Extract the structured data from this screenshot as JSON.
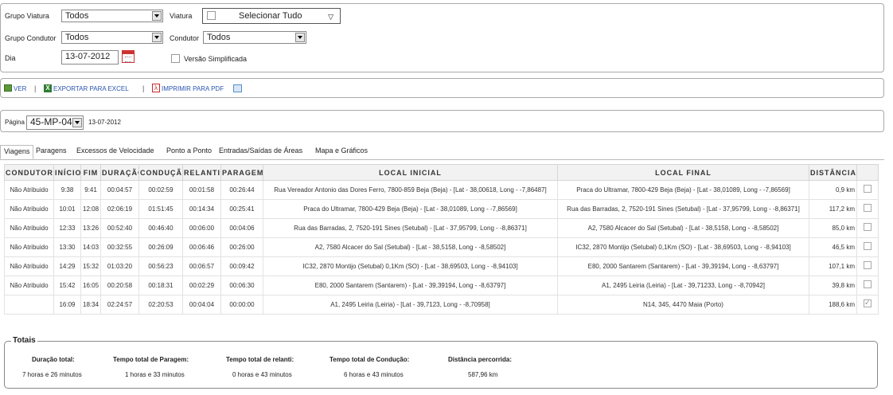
{
  "filters": {
    "grupo_viatura_label": "Grupo Viatura",
    "grupo_viatura_value": "Todos",
    "viatura_label": "Viatura",
    "viatura_value": "Selecionar Tudo",
    "grupo_condutor_label": "Grupo Condutor",
    "grupo_condutor_value": "Todos",
    "condutor_label": "Condutor",
    "condutor_value": "Todos",
    "dia_label": "Dia",
    "dia_value": "13-07-2012",
    "versao_label": "Versão Simplificada"
  },
  "toolbar": {
    "ver": "VER",
    "exportar": "EXPORTAR PARA EXCEL",
    "imprimir": "IMPRIMIR PARA PDF",
    "sep": "|"
  },
  "pager": {
    "label": "Página",
    "value": "45-MP-04",
    "date": "13-07-2012"
  },
  "tabs": [
    "Viagens",
    "Paragens",
    "Excessos de Velocidade",
    "Ponto a Ponto",
    "Entradas/Saídas de Áreas",
    "Mapa e Gráficos"
  ],
  "table": {
    "headers": [
      "CONDUTOR",
      "INÍCIO",
      "FIM",
      "DURAÇÃO",
      "CONDUÇÃO",
      "RELANTI",
      "PARAGEM",
      "LOCAL INICIAL",
      "LOCAL FINAL",
      "DISTÂNCIA",
      ""
    ],
    "rows": [
      [
        "Não Atribuido",
        "9:38",
        "9:41",
        "00:04:57",
        "00:02:59",
        "00:01:58",
        "00:26:44",
        "Rua Vereador Antonio das Dores Ferro, 7800-859 Beja (Beja) - [Lat - 38,00618, Long - -7,86487]",
        "Praca do Ultramar, 7800-429 Beja (Beja) - [Lat - 38,01089, Long - -7,86569]",
        "0,9 km"
      ],
      [
        "Não Atribuido",
        "10:01",
        "12:08",
        "02:06:19",
        "01:51:45",
        "00:14:34",
        "00:25:41",
        "Praca do Ultramar, 7800-429 Beja (Beja) - [Lat - 38,01089, Long - -7,86569]",
        "Rua das Barradas, 2, 7520-191 Sines (Setubal) - [Lat - 37,95799, Long - -8,86371]",
        "117,2 km"
      ],
      [
        "Não Atribuido",
        "12:33",
        "13:26",
        "00:52:40",
        "00:46:40",
        "00:06:00",
        "00:04:06",
        "Rua das Barradas, 2, 7520-191 Sines (Setubal) - [Lat - 37,95799, Long - -8,86371]",
        "A2, 7580 Alcacer do Sal (Setubal) - [Lat - 38,5158, Long - -8,58502]",
        "85,0 km"
      ],
      [
        "Não Atribuido",
        "13:30",
        "14:03",
        "00:32:55",
        "00:26:09",
        "00:06:46",
        "00:26:00",
        "A2, 7580 Alcacer do Sal (Setubal) - [Lat - 38,5158, Long - -8,58502]",
        "IC32, 2870 Montijo (Setubal) 0,1Km (SO) - [Lat - 38,69503, Long - -8,94103]",
        "46,5 km"
      ],
      [
        "Não Atribuido",
        "14:29",
        "15:32",
        "01:03:20",
        "00:56:23",
        "00:06:57",
        "00:09:42",
        "IC32, 2870 Montijo (Setubal) 0,1Km (SO) - [Lat - 38,69503, Long - -8,94103]",
        "E80, 2000 Santarem (Santarem) - [Lat - 39,39194, Long - -8,63797]",
        "107,1 km"
      ],
      [
        "Não Atribuido",
        "15:42",
        "16:05",
        "00:20:58",
        "00:18:31",
        "00:02:29",
        "00:06:30",
        "E80, 2000 Santarem (Santarem) - [Lat - 39,39194, Long - -8,63797]",
        "A1, 2495 Leiria (Leiria) - [Lat - 39,71233, Long - -8,70942]",
        "39,8 km"
      ],
      [
        "",
        "16:09",
        "18:34",
        "02:24:57",
        "02:20:53",
        "00:04:04",
        "00:00:00",
        "A1, 2495 Leiria (Leiria) - [Lat - 39,7123, Long - -8,70958]",
        "N14, 345, 4470 Maia (Porto)",
        "188,6 km"
      ]
    ]
  },
  "totals": {
    "title": "Totais",
    "duracao_label": "Duração total:",
    "duracao_value": "7 horas e 26 minutos",
    "paragem_label": "Tempo total de Paragem:",
    "paragem_value": "1 horas e 33 minutos",
    "relanti_label": "Tempo total de relanti:",
    "relanti_value": "0 horas e 43 minutos",
    "conducao_label": "Tempo total de Condução:",
    "conducao_value": "6 horas e 43 minutos",
    "distancia_label": "Distância percorrida:",
    "distancia_value": "587,96 km"
  }
}
